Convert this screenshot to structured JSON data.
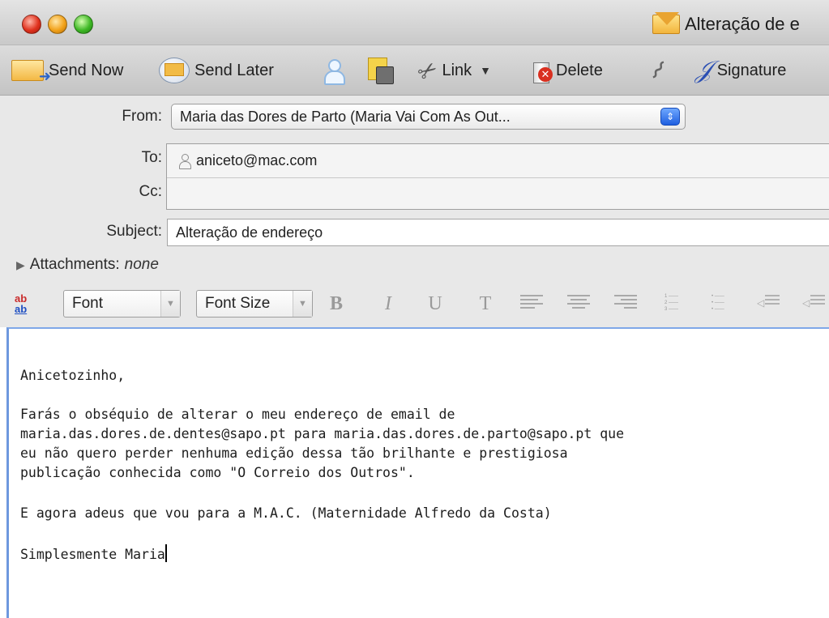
{
  "window": {
    "title": "Alteração de e",
    "title_icon": "envelope-icon",
    "controls": [
      "close",
      "minimize",
      "zoom"
    ]
  },
  "toolbar": {
    "send_now": "Send Now",
    "send_later": "Send Later",
    "link": "Link",
    "delete": "Delete",
    "signature": "Signature"
  },
  "headers": {
    "from_label": "From:",
    "from_value": "Maria das Dores de Parto (Maria Vai Com As Out...",
    "to_label": "To:",
    "to_value": "aniceto@mac.com",
    "cc_label": "Cc:",
    "cc_value": "",
    "subject_label": "Subject:",
    "subject_value": "Alteração de endereço",
    "attachments_label": "Attachments:",
    "attachments_value": "none"
  },
  "format_bar": {
    "font": "Font",
    "font_size": "Font Size",
    "bold": "B",
    "italic": "I",
    "underline": "U",
    "text_style": "T",
    "spell_top": "ab",
    "spell_bottom": "ab"
  },
  "body": {
    "lines": [
      "Anicetozinho,",
      "Farás o obséquio de alterar o meu endereço de email de",
      "maria.das.dores.de.dentes@sapo.pt para maria.das.dores.de.parto@sapo.pt que",
      "eu não quero perder nenhuma edição dessa tão brilhante e prestigiosa",
      "publicação conhecida como \"O Correio dos Outros\".",
      "E agora adeus que vou para a M.A.C. (Maternidade Alfredo da Costa)",
      "Simplesmente Maria"
    ]
  },
  "colors": {
    "window_chrome": "#d4d4d4",
    "focus_ring": "#7fa7e8",
    "close": "#e0321e",
    "minimize": "#f2a21a",
    "zoom": "#3fb826"
  }
}
